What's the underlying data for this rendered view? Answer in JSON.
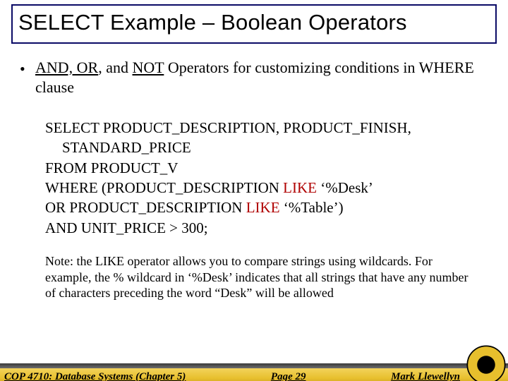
{
  "title": "SELECT Example – Boolean Operators",
  "bullet": {
    "pre": "AND, OR",
    "mid": ", and ",
    "not": "NOT",
    "post": " Operators for customizing conditions in WHERE clause"
  },
  "sql": {
    "l1": "SELECT PRODUCT_DESCRIPTION, PRODUCT_FINISH,",
    "l2": "STANDARD_PRICE",
    "l3": "FROM PRODUCT_V",
    "l4a": "WHERE (PRODUCT_DESCRIPTION ",
    "l4kw": "LIKE",
    "l4b": " ‘%Desk’",
    "l5a": "OR PRODUCT_DESCRIPTION ",
    "l5kw": "LIKE",
    "l5b": " ‘%Table’)",
    "l6": "AND UNIT_PRICE > 300;"
  },
  "note": "Note: the LIKE operator allows you to compare strings using wildcards. For example, the % wildcard in ‘%Desk’  indicates that all strings that have any number of characters preceding the word “Desk” will be allowed",
  "footer": {
    "left": "COP 4710: Database Systems  (Chapter 5)",
    "center": "Page 29",
    "right": "Mark Llewellyn"
  }
}
